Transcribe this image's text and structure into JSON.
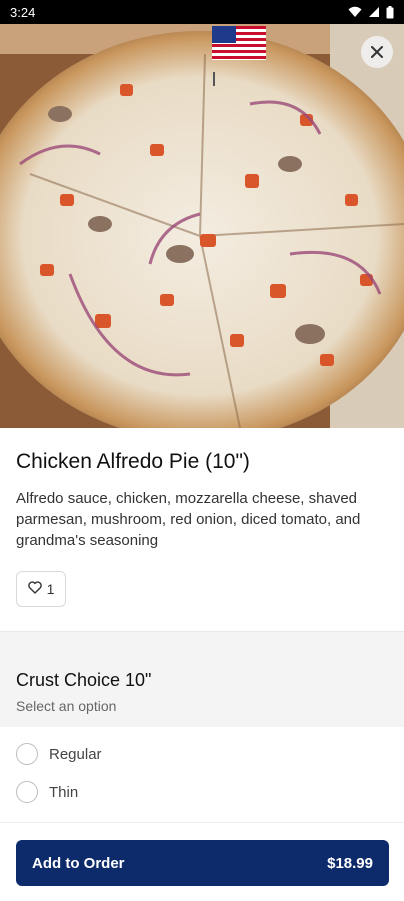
{
  "status_bar": {
    "time": "3:24"
  },
  "item": {
    "title": "Chicken Alfredo Pie (10\")",
    "description": "Alfredo sauce, chicken, mozzarella cheese, shaved parmesan, mushroom, red onion, diced tomato, and grandma's seasoning",
    "like_count": "1"
  },
  "option_group": {
    "title": "Crust Choice 10\"",
    "subtitle": "Select an option",
    "options": [
      {
        "label": "Regular"
      },
      {
        "label": "Thin"
      }
    ]
  },
  "footer": {
    "add_label": "Add to Order",
    "price": "$18.99"
  },
  "colors": {
    "primary": "#0d2b6b",
    "background": "#ffffff",
    "section_bg": "#f4f4f4"
  },
  "icons": [
    "wifi-icon",
    "signal-icon",
    "battery-icon",
    "close-icon",
    "heart-icon"
  ]
}
